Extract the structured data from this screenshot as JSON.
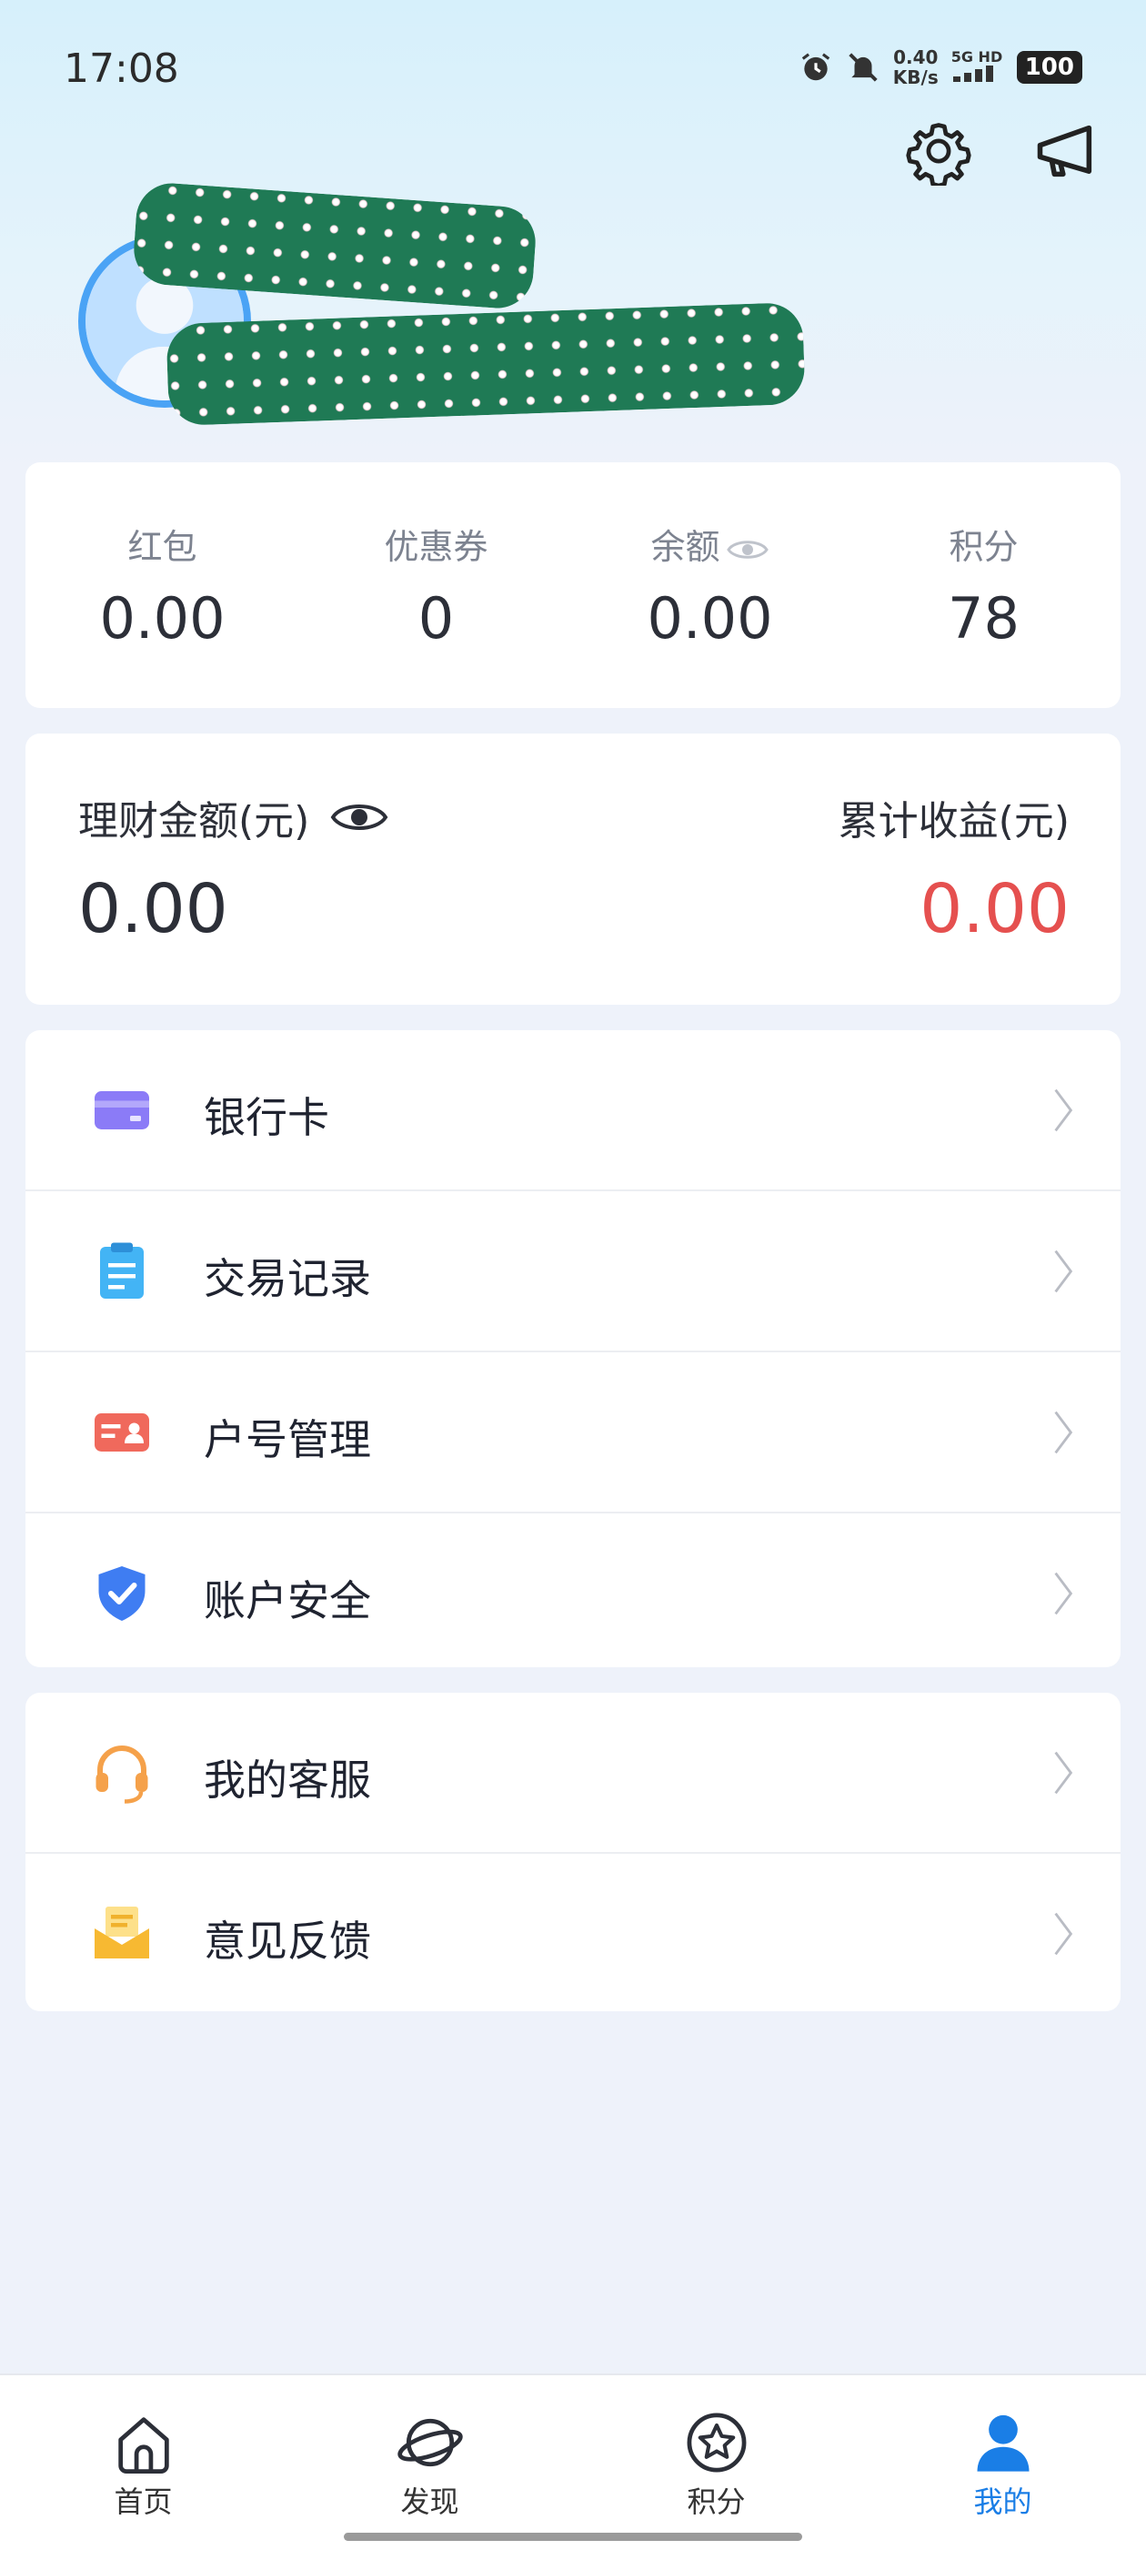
{
  "status_bar": {
    "time": "17:08",
    "net_speed_value": "0.40",
    "net_speed_unit": "KB/s",
    "signal": "5G HD",
    "battery": "100"
  },
  "header": {
    "settings_icon": "gear-icon",
    "notice_icon": "megaphone-icon"
  },
  "profile": {
    "avatar_icon": "user-avatar"
  },
  "stats": [
    {
      "label": "红包",
      "value": "0.00"
    },
    {
      "label": "优惠券",
      "value": "0"
    },
    {
      "label": "余额",
      "value": "0.00"
    },
    {
      "label": "积分",
      "value": "78"
    }
  ],
  "wealth": {
    "amount_label": "理财金额(元)",
    "amount_value": "0.00",
    "income_label": "累计收益(元)",
    "income_value": "0.00",
    "income_color": "#e5504f"
  },
  "menu_group1": [
    {
      "label": "银行卡",
      "icon": "bank-card-icon"
    },
    {
      "label": "交易记录",
      "icon": "clipboard-icon"
    },
    {
      "label": "户号管理",
      "icon": "id-card-icon"
    },
    {
      "label": "账户安全",
      "icon": "shield-icon"
    }
  ],
  "menu_group2": [
    {
      "label": "我的客服",
      "icon": "headset-icon"
    },
    {
      "label": "意见反馈",
      "icon": "envelope-icon"
    }
  ],
  "nav": [
    {
      "label": "首页",
      "icon": "home-icon"
    },
    {
      "label": "发现",
      "icon": "planet-icon"
    },
    {
      "label": "积分",
      "icon": "star-icon"
    },
    {
      "label": "我的",
      "icon": "user-icon",
      "active": true
    }
  ],
  "colors": {
    "accent": "#1a7ee6",
    "income": "#e5504f"
  }
}
